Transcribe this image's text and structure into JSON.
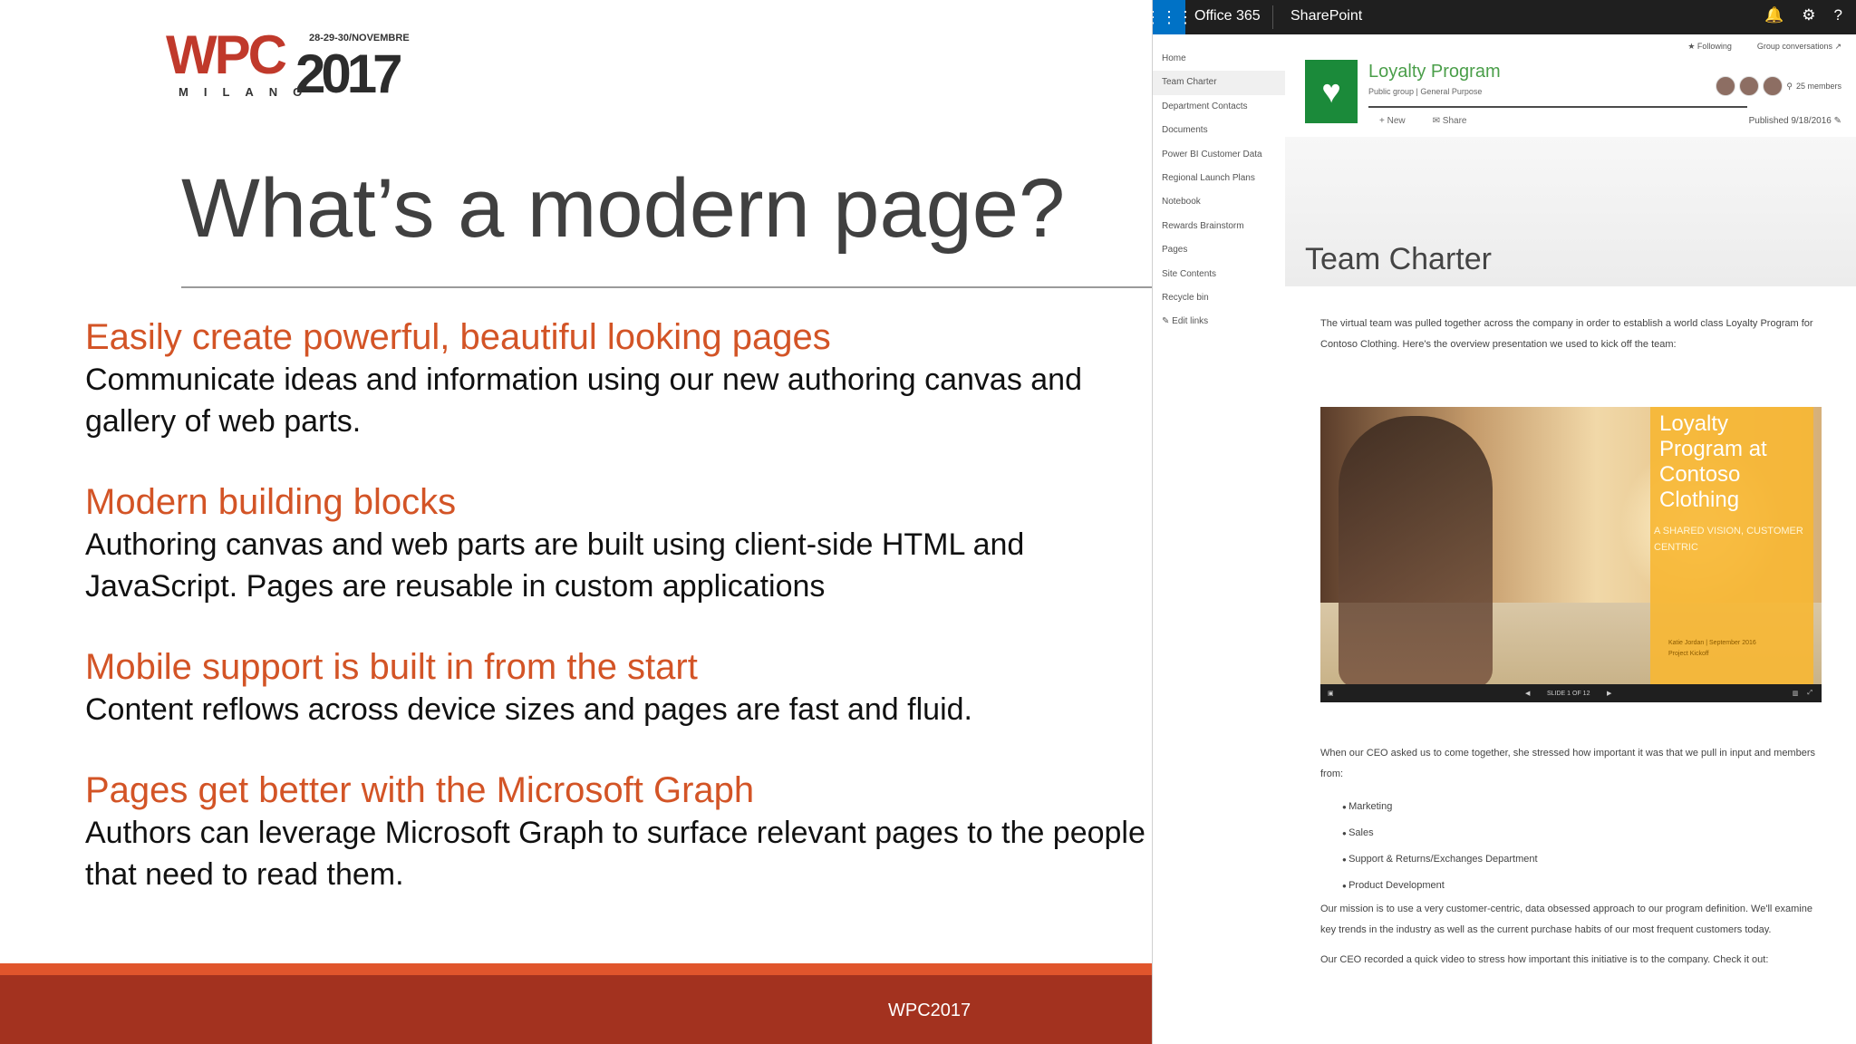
{
  "logo": {
    "brand": "WPC",
    "year": "2017",
    "dates": "28-29-30/NOVEMBRE",
    "city": "MILANO"
  },
  "slide": {
    "title": "What’s a modern page?",
    "points": [
      {
        "heading": "Easily create powerful, beautiful looking pages",
        "text": "Communicate ideas and information using our new authoring canvas and gallery of web parts."
      },
      {
        "heading": "Modern building blocks",
        "text": "Authoring canvas and web parts are built using client-side HTML and JavaScript. Pages are reusable in custom applications"
      },
      {
        "heading": "Mobile support is built in from the start",
        "text": "Content reflows across device sizes and pages are fast and fluid."
      },
      {
        "heading": "Pages get better with the Microsoft Graph",
        "text": "Authors can leverage Microsoft Graph to surface relevant pages to the people that need to read them."
      }
    ],
    "footer": "WPC2017"
  },
  "sharepoint": {
    "topbar": {
      "suite": "Office 365",
      "app": "SharePoint",
      "icons": [
        "bell-icon",
        "gear-icon",
        "help-icon"
      ]
    },
    "nav": [
      "Home",
      "Team Charter",
      "Department Contacts",
      "Documents",
      "Power BI Customer Data",
      "Regional Launch Plans",
      "Notebook",
      "Rewards Brainstorm",
      "Pages",
      "Site Contents",
      "Recycle bin",
      "Edit links"
    ],
    "follow": {
      "following": "★ Following",
      "group": "Group conversations ↗"
    },
    "site": {
      "name": "Loyalty Program",
      "sub": "Public group | General Purpose",
      "members": "25 members"
    },
    "commands": {
      "new": "+ New",
      "share": "Share",
      "published": "Published 9/18/2016"
    },
    "page_title": "Team Charter",
    "intro": "The virtual team was pulled together across the company in order to establish a world class Loyalty Program for Contoso Clothing. Here's the overview presentation we used to kick off the team:",
    "video": {
      "card_title": "Loyalty Program at Contoso Clothing",
      "card_sub": "A SHARED VISION, CUSTOMER CENTRIC",
      "card_date": "Katie Jordan | September 2016",
      "card_project": "Project Kickoff",
      "slide_counter": "SLIDE 1 OF 12"
    },
    "body": {
      "p1": "When our CEO asked us to come together, she stressed how important it was that we pull in input and  members from:",
      "list": [
        "Marketing",
        "Sales",
        "Support & Returns/Exchanges Department",
        "Product Development"
      ],
      "p2": "Our mission is to use a very customer-centric, data obsessed approach to our program definition. We'll examine key trends in the industry as well as the current purchase habits of our most frequent customers today.",
      "p3": "Our CEO recorded a quick video to stress how important this initiative is to the company. Check it out:"
    }
  }
}
